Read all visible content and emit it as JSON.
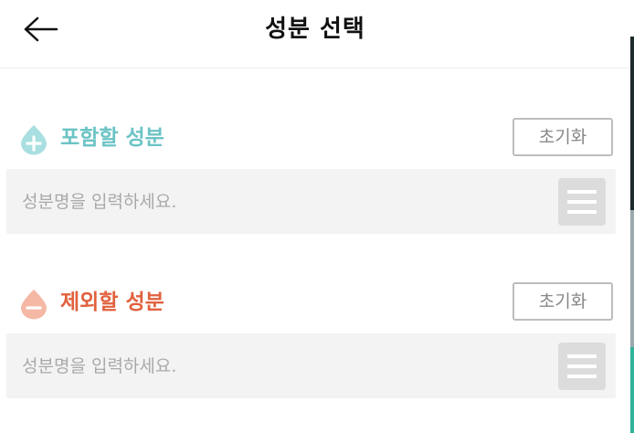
{
  "header": {
    "title": "성분 선택",
    "back_icon": "arrow-left-icon"
  },
  "include": {
    "label": "포함할 성분",
    "color": "#6cc3c5",
    "icon": "plus-drop-icon",
    "reset_label": "초기화",
    "search_placeholder": "성분명을 입력하세요.",
    "menu_icon": "hamburger-menu-icon"
  },
  "exclude": {
    "label": "제외할 성분",
    "color": "#e1613e",
    "icon": "minus-drop-icon",
    "reset_label": "초기화",
    "search_placeholder": "성분명을 입력하세요.",
    "menu_icon": "hamburger-menu-icon"
  }
}
